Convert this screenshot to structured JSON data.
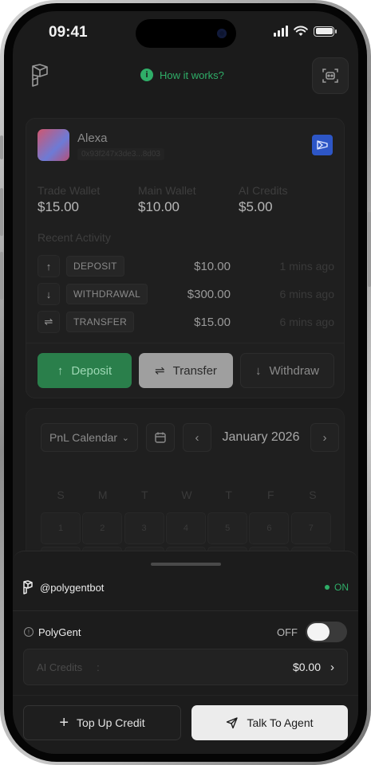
{
  "status": {
    "time": "09:41"
  },
  "header": {
    "help_link": "How it works?",
    "help_icon": "info-icon",
    "bot_icon": "robot-icon"
  },
  "wallet": {
    "user_name": "Alexa",
    "address": "0x93f247x3de3...8d03",
    "balances": [
      {
        "label": "Trade Wallet",
        "value": "$15.00"
      },
      {
        "label": "Main Wallet",
        "value": "$10.00"
      },
      {
        "label": "AI Credits",
        "value": "$5.00"
      }
    ],
    "recent_title": "Recent Activity",
    "activity": [
      {
        "icon": "arrow-up-icon",
        "glyph": "↑",
        "type": "DEPOSIT",
        "amount": "$10.00",
        "time": "1 mins ago"
      },
      {
        "icon": "arrow-down-icon",
        "glyph": "↓",
        "type": "WITHDRAWAL",
        "amount": "$300.00",
        "time": "6 mins ago"
      },
      {
        "icon": "swap-icon",
        "glyph": "⇌",
        "type": "TRANSFER",
        "amount": "$15.00",
        "time": "6 mins ago"
      }
    ],
    "actions": {
      "deposit": "Deposit",
      "transfer": "Transfer",
      "withdraw": "Withdraw"
    }
  },
  "calendar": {
    "select_label": "PnL Calendar",
    "month": "January 2026",
    "weekdays": [
      "S",
      "M",
      "T",
      "W",
      "T",
      "F",
      "S"
    ],
    "days": [
      "1",
      "2",
      "3",
      "4",
      "5",
      "6",
      "7"
    ]
  },
  "sheet": {
    "bot_handle": "@polygentbot",
    "bot_status": "ON",
    "agent_name": "PolyGent",
    "agent_toggle_label": "OFF",
    "agent_toggle_on": false,
    "credits_label": "AI Credits",
    "credits_sep": ":",
    "credits_value": "$0.00",
    "topup_label": "Top Up Credit",
    "talk_label": "Talk To Agent"
  },
  "colors": {
    "accent_green": "#2fae68",
    "deposit_bg": "#2a7f4b",
    "chain_badge": "#2d56c6"
  }
}
